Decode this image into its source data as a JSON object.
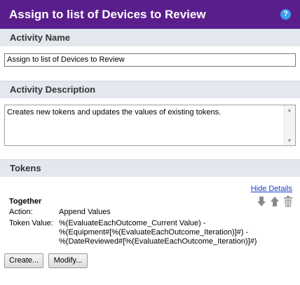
{
  "dialog": {
    "title": "Assign to list of Devices to Review",
    "help_label": "?"
  },
  "activity_name": {
    "heading": "Activity Name",
    "value": "Assign to list of Devices to Review"
  },
  "activity_description": {
    "heading": "Activity Description",
    "value": "Creates new tokens and updates the values of existing tokens."
  },
  "tokens": {
    "heading": "Tokens",
    "hide_details_label": "Hide Details",
    "items": [
      {
        "name": "Together",
        "action_label": "Action:",
        "action_value": "Append Values",
        "token_value_label": "Token Value:",
        "token_value_lines": [
          "%(EvaluateEachOutcome_Current Value) -",
          "%(Equipment#[%(EvaluateEachOutcome_Iteration)]#) -",
          "%(DateReviewed#[%(EvaluateEachOutcome_Iteration)]#)"
        ]
      }
    ],
    "create_label": "Create...",
    "modify_label": "Modify..."
  },
  "icons": [
    "move-down-icon",
    "move-up-icon",
    "delete-icon",
    "help-icon"
  ],
  "colors": {
    "titlebar": "#5a1e8c",
    "section_header": "#e3e8ef",
    "link": "#1a3fc4",
    "help": "#3aa0ee"
  }
}
